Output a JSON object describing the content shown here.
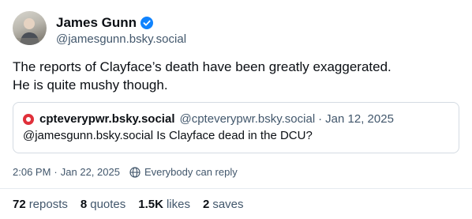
{
  "author": {
    "display_name": "James Gunn",
    "handle": "@jamesgunn.bsky.social",
    "verified": true,
    "avatar_icon": "user-avatar"
  },
  "post": {
    "lines": [
      "The reports of Clayface’s death have been greatly exaggerated.",
      "He is quite mushy though."
    ]
  },
  "quote": {
    "display_name": "cpteverypwr.bsky.social",
    "handle": "@cpteverypwr.bsky.social",
    "separator": "·",
    "date": "Jan 12, 2025",
    "text": "@jamesgunn.bsky.social Is Clayface dead in the DCU?",
    "avatar_color": "#e0303a"
  },
  "meta": {
    "time": "2:06 PM",
    "separator": "·",
    "date": "Jan 22, 2025",
    "visibility": "Everybody can reply",
    "visibility_icon": "globe-icon"
  },
  "stats": {
    "reposts": {
      "count": "72",
      "label": "reposts"
    },
    "quotes": {
      "count": "8",
      "label": "quotes"
    },
    "likes": {
      "count": "1.5K",
      "label": "likes"
    },
    "saves": {
      "count": "2",
      "label": "saves"
    }
  },
  "colors": {
    "text": "#0b0f14",
    "muted": "#42576c",
    "verified_badge": "#1083fe",
    "border": "#d4dbe2"
  }
}
